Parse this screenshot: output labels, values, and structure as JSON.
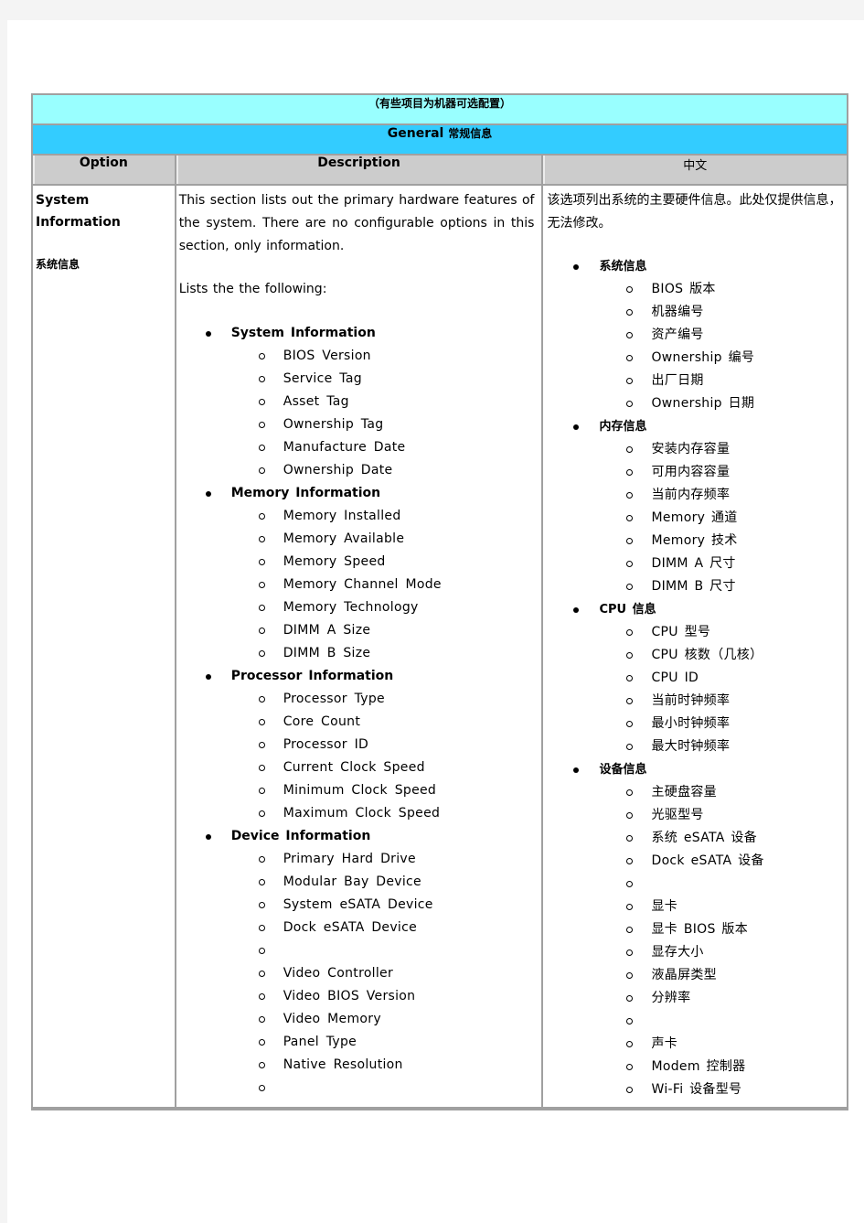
{
  "table": {
    "note_row": "（有些项目为机器可选配置）",
    "general_row": {
      "en": "General",
      "zh": "常规信息"
    },
    "headers": {
      "option": "Option",
      "description": "Description",
      "chinese": "中文"
    },
    "row": {
      "option": {
        "title": "System Information",
        "zh": "系统信息"
      },
      "description": {
        "intro": "This section lists out the primary hardware features of the system. There are no configurable options in this section, only information.",
        "lead": "Lists the the following:",
        "groups": [
          {
            "label": "System Information",
            "items": [
              "BIOS Version",
              "Service Tag",
              "Asset Tag",
              "Ownership Tag",
              "Manufacture Date",
              "Ownership Date"
            ]
          },
          {
            "label": "Memory Information",
            "items": [
              "Memory Installed",
              "Memory Available",
              "Memory Speed",
              "Memory Channel Mode",
              "Memory Technology",
              "DIMM A Size",
              "DIMM B Size"
            ]
          },
          {
            "label": "Processor Information",
            "items": [
              "Processor Type",
              "Core Count",
              "Processor ID",
              "Current Clock Speed",
              "Minimum Clock Speed",
              "Maximum Clock Speed"
            ]
          },
          {
            "label": "Device Information",
            "items": [
              "Primary Hard Drive",
              "Modular Bay Device",
              "System eSATA Device",
              "Dock eSATA Device",
              "",
              "Video Controller",
              "Video BIOS Version",
              "Video Memory",
              "Panel Type",
              "Native Resolution",
              ""
            ]
          }
        ]
      },
      "chinese": {
        "intro": "该选项列出系统的主要硬件信息。此处仅提供信息，无法修改。",
        "groups": [
          {
            "label": "系统信息",
            "items": [
              "BIOS 版本",
              "机器编号",
              "资产编号",
              "Ownership 编号",
              "出厂日期",
              "Ownership 日期"
            ]
          },
          {
            "label": "内存信息",
            "items": [
              "安装内存容量",
              "可用内容容量",
              "当前内存频率",
              "Memory 通道",
              "Memory 技术",
              "DIMM A 尺寸",
              "DIMM B 尺寸"
            ]
          },
          {
            "label": "CPU 信息",
            "items": [
              "CPU 型号",
              "CPU 核数（几核）",
              "CPU ID",
              "当前时钟频率",
              "最小时钟频率",
              "最大时钟频率"
            ]
          },
          {
            "label": "设备信息",
            "items": [
              "主硬盘容量",
              "光驱型号",
              "系统 eSATA 设备",
              "Dock eSATA 设备",
              "",
              "显卡",
              "显卡 BIOS 版本",
              "显存大小",
              "液晶屏类型",
              "分辨率",
              "",
              "声卡",
              "Modem 控制器",
              "Wi-Fi 设备型号"
            ]
          }
        ]
      }
    }
  },
  "colors": {
    "note_row_bg": "#99ffff",
    "general_row_bg": "#33ccff",
    "header_bg": "#cccccc",
    "border": "#a0a0a0"
  }
}
